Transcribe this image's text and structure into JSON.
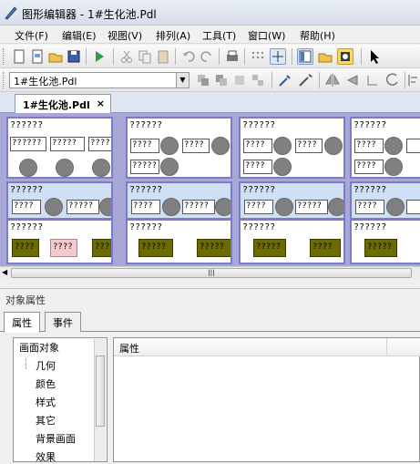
{
  "window": {
    "title": "图形编辑器 - 1#生化池.Pdl"
  },
  "menu": [
    "文件(F)",
    "编辑(E)",
    "视图(V)",
    "排列(A)",
    "工具(T)",
    "窗口(W)",
    "帮助(H)"
  ],
  "toolbar2": {
    "combo_value": "1#生化池.Pdl"
  },
  "doc_tab": {
    "label": "1#生化池.Pdl",
    "close": "×"
  },
  "canvas": {
    "cells": [
      {
        "label": "??????",
        "boxes": [
          "??????",
          "?????",
          "????"
        ]
      },
      {
        "label": "??????",
        "boxes": [
          "????",
          "????",
          "?????"
        ]
      },
      {
        "label": "??????",
        "boxes": [
          "????",
          "????",
          "????"
        ]
      },
      {
        "label": "??????",
        "boxes": [
          "????",
          "????"
        ]
      },
      {
        "label": "??????",
        "boxes": [
          "????",
          "?????"
        ]
      },
      {
        "label": "??????",
        "boxes": [
          "????",
          "?????"
        ]
      },
      {
        "label": "??????",
        "boxes": [
          "????",
          "?????"
        ]
      },
      {
        "label": "??????",
        "boxes": [
          "????"
        ]
      },
      {
        "label": "??????",
        "boxes": [
          "????",
          "????",
          "????"
        ]
      },
      {
        "label": "??????",
        "boxes": [
          "?????",
          "?????"
        ]
      },
      {
        "label": "??????",
        "boxes": [
          "?????",
          "????"
        ]
      },
      {
        "label": "??????",
        "boxes": [
          "?????"
        ]
      }
    ]
  },
  "scroll": {
    "thumb_label": "|||"
  },
  "props": {
    "section_title": "对象属性",
    "tabs": [
      "属性",
      "事件"
    ],
    "tree": [
      "画面对象",
      "几何",
      "颜色",
      "样式",
      "其它",
      "背景画面",
      "效果"
    ],
    "grid_header": "属性"
  },
  "colors": {
    "canvas_bg": "#a7a7d8",
    "cell_border": "#7b7bc8",
    "olive": "#6b6b00",
    "pink": "#f5c8cc"
  }
}
